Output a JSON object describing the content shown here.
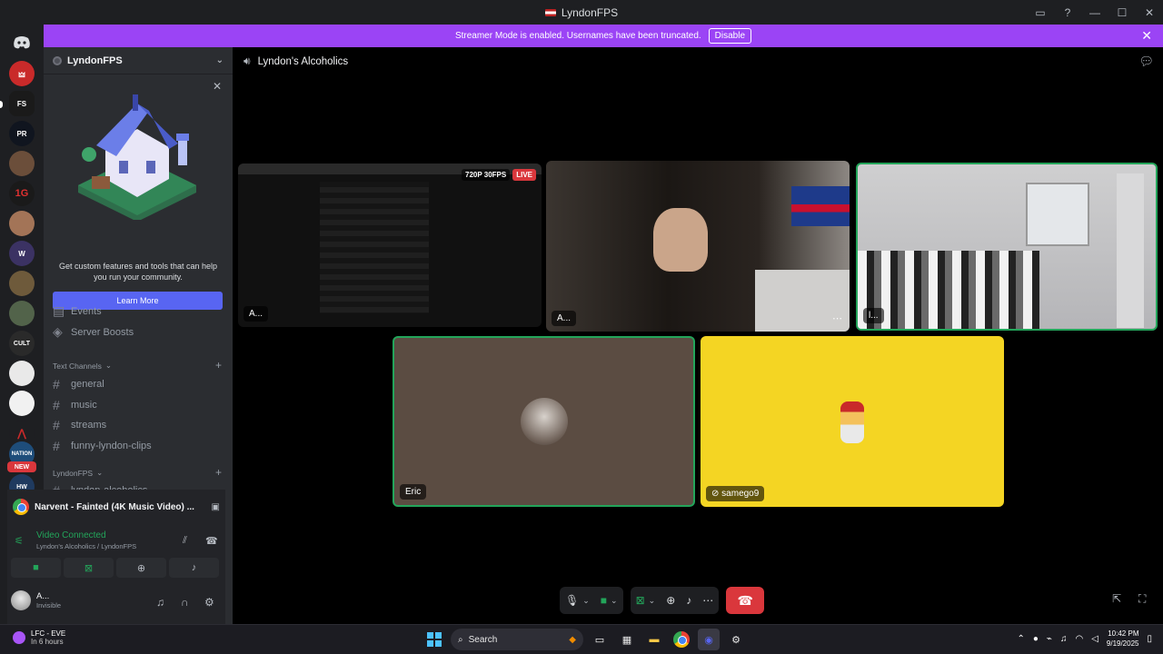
{
  "window": {
    "title": "LyndonFPS"
  },
  "banner": {
    "text": "Streamer Mode is enabled. Usernames have been truncated.",
    "disable_label": "Disable"
  },
  "server": {
    "name": "LyndonFPS",
    "promo_text": "Get custom features and tools that can help you run your community.",
    "promo_button": "Learn More",
    "nav": [
      {
        "label": "Events"
      },
      {
        "label": "Server Boosts"
      }
    ],
    "text_category": "Text Channels",
    "text_channels": [
      "general",
      "music",
      "streams",
      "funny-lyndon-clips"
    ],
    "voice_category": "LyndonFPS",
    "voice_channel_partial": "lyndon-alcoholics"
  },
  "guild_badge_new": "NEW",
  "activity": {
    "title": "Narvent - Fainted (4K Music Video) ..."
  },
  "voice": {
    "status": "Video Connected",
    "location": "Lyndon's Alcoholics / LyndonFPS"
  },
  "user": {
    "name": "A...",
    "status": "Invisible"
  },
  "channel": {
    "name": "Lyndon's Alcoholics"
  },
  "tiles": [
    {
      "name": "A...",
      "quality": "720P 30FPS",
      "live": "LIVE"
    },
    {
      "name": "A..."
    },
    {
      "name": "l..."
    },
    {
      "name": "Eric"
    },
    {
      "name": "samego9"
    }
  ],
  "taskbar": {
    "weather_title": "LFC - EVE",
    "weather_sub": "In 6 hours",
    "search_placeholder": "Search",
    "time": "10:42 PM",
    "date": "9/19/2025"
  },
  "colors": {
    "accent": "#5865f2",
    "streamer_banner": "#9b44f5",
    "connected": "#23a55a",
    "hangup": "#da373c",
    "tile_eric": "#5b4c42",
    "tile_samego": "#f4d523"
  }
}
